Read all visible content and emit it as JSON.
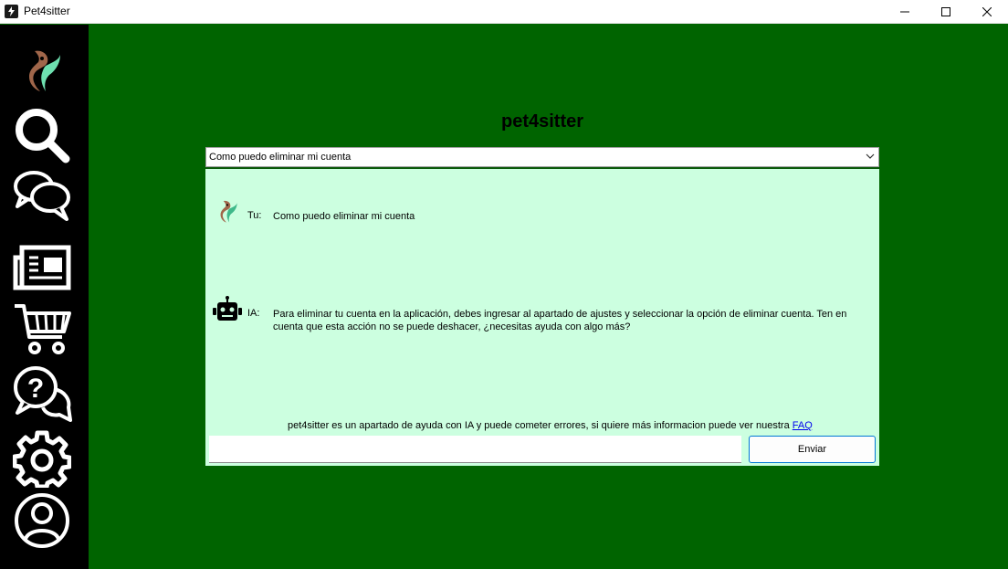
{
  "window": {
    "title": "Pet4sitter"
  },
  "sidebar": {
    "items": [
      {
        "name": "logo"
      },
      {
        "name": "search"
      },
      {
        "name": "chats"
      },
      {
        "name": "news"
      },
      {
        "name": "shop"
      },
      {
        "name": "help"
      },
      {
        "name": "settings"
      },
      {
        "name": "profile"
      }
    ]
  },
  "main": {
    "title": "pet4sitter",
    "question_select": {
      "selected": "Como puedo eliminar mi cuenta"
    },
    "messages": [
      {
        "sender_label": "Tu:",
        "avatar": "pet4sitter-logo-icon",
        "text": "Como puedo eliminar mi cuenta"
      },
      {
        "sender_label": "IA:",
        "avatar": "robot-icon",
        "text": "Para eliminar tu cuenta en la aplicación, debes ingresar al apartado de ajustes y seleccionar la opción de eliminar cuenta. Ten en cuenta que esta acción no se puede deshacer, ¿necesitas ayuda con algo más?"
      }
    ],
    "disclaimer": "pet4sitter es un apartado de ayuda con IA y puede cometer errores, si quiere más informacion puede ver nuestra ",
    "faq_link": "FAQ",
    "input": {
      "value": "",
      "placeholder": ""
    },
    "send_label": "Enviar"
  },
  "colors": {
    "background": "#006400",
    "sidebar": "#000000",
    "chat_panel": "#ccffe0",
    "accent": "#0078d4"
  }
}
